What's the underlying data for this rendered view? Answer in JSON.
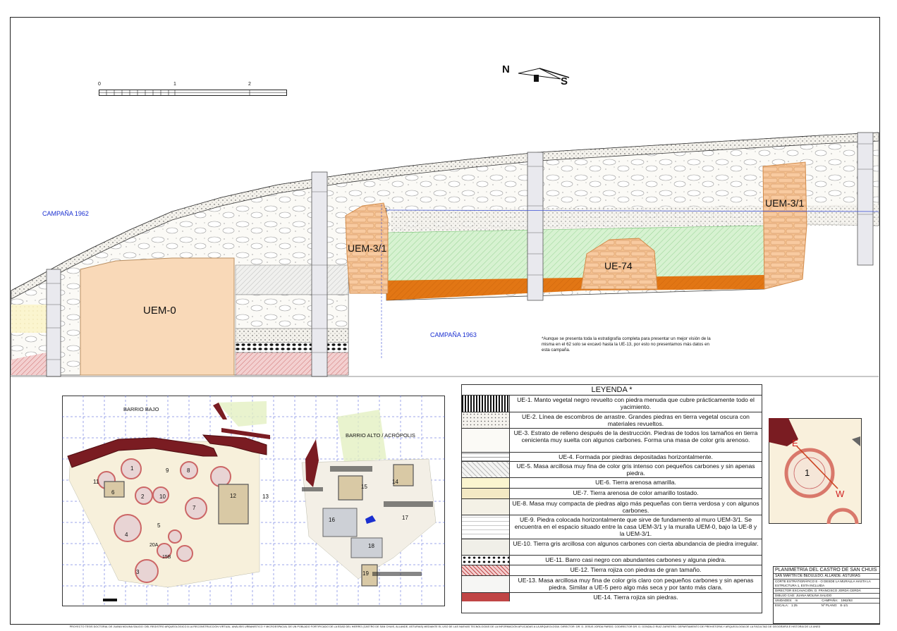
{
  "orientation": {
    "north": "N",
    "south": "S"
  },
  "scale_bar": {
    "labels": [
      "0",
      "1",
      "2"
    ]
  },
  "section": {
    "campaign_1962": "CAMPAÑA 1962",
    "campaign_1963": "CAMPAÑA 1963",
    "walls": {
      "uem0": "UEM-0",
      "uem31_a": "UEM-3/1",
      "uem31_b": "UEM-3/1",
      "ue74": "UE-74"
    },
    "note": "*Aunque se presenta toda la estratigrafía completa para presentar un mejor visión de la misma en el 62 solo se excavó hasta la UE-13, por esto no presentamos más datos en esta campaña."
  },
  "plan": {
    "barrio_bajo": "BARRIO BAJO",
    "barrio_alto": "BARRIO ALTO / ACRÓPOLIS",
    "numbers": [
      "1",
      "2",
      "3",
      "4",
      "5",
      "6",
      "7",
      "8",
      "9",
      "10",
      "11",
      "12",
      "13",
      "14",
      "15",
      "16",
      "17",
      "18",
      "19",
      "15B",
      "20A"
    ]
  },
  "inset": {
    "e": "E",
    "w": "W",
    "n1": "1"
  },
  "legend": {
    "title": "LEYENDA *",
    "rows": [
      "UE-1. Manto vegetal negro revuelto con piedra menuda que cubre prácticamente todo el yacimiento.",
      "UE-2. Línea de escombros de arrastre. Grandes piedras en tierra vegetal oscura con materiales revueltos.",
      "UE-3. Estrato de relleno después de la destrucción. Piedras de todos los tamaños en tierra cenicienta muy suelta con algunos carbones. Forma una masa de color gris arenoso.",
      "UE-4. Formada por piedras depositadas horizontalmente.",
      "UE-5. Masa arcillosa muy fina de color gris intenso con pequeños carbones y sin apenas piedra.",
      "UE-6. Tierra arenosa amarilla.",
      "UE-7. Tierra arenosa de color amarillo tostado.",
      "UE-8. Masa muy compacta de piedras algo más pequeñas con tierra verdosa y con algunos carbones.",
      "UE-9. Piedra colocada horizontalmente que sirve de fundamento al muro UEM-3/1. Se encuentra en el espacio situado entre la casa UEM-3/1 y la muralla UEM-0, bajo la UE-8 y la UEM-3/1.",
      "UE-10. Tierra gris arcillosa con algunos carbones con cierta abundancia de piedra irregular.",
      "UE-11. Barro casi negro con abundantes carbones y alguna piedra.",
      "UE-12. Tierra rojiza con piedras de gran tamaño.",
      "UE-13. Masa arcillosa muy fina de color gris claro con pequeños carbones y sin apenas piedra. Similar a UE-5 pero algo más seca y por tanto más clara.",
      "UE-14. Tierra rojiza sin piedras."
    ]
  },
  "titleblock": {
    "title": "PLANIMETRÍA DEL CASTRO DE SAN CHUIS",
    "subtitle": "SAN MARTÍN DE BEDULEDO. ALLANDE. ASTURIAS",
    "desc": "CORTE ESTRATIGRÁFICO E - O DESDE LA MURALLA HASTA LA ESTRUCTURA 1, ESTA INCLUIDA",
    "director": "DIRECTOR EXCAVACIÓN: D. FRANCISCO JORDÁ CERDÁ",
    "drawing": "DIBUJO CAD: JUANA MOLINA SALIDO",
    "units_label": "UNIDADES:",
    "units": "m",
    "campaign_label": "CAMPAÑA:",
    "campaign": "1962/63",
    "scale_label": "ESCALA:",
    "scale": "1:25",
    "plane_label": "Nº PLANO:",
    "plane": "E-1/1"
  },
  "footer": "PROYECTO TESIS DOCTORAL DE JUANA MOLINA SALIDO: DEL REGISTRO ARQUEOLÓGICO A LA RECONSTRUCCIÓN VIRTUAL. ANÁLISIS URBANÍSTICO Y MICROESPACIAL DE UN POBLADO FORTIFICADO DE LA EDAD DEL HIERRO (CASTRO DE SAN CHUIS, ALLANDE, ASTURIAS) MEDIANTE EL USO DE LAS NUEVAS TECNOLOGÍAS DE LA INFORMACIÓN APLICADAS A LA ARQUEOLOGÍA. DIRECTOR: DR. D. JESÚS JORDÁ PARDO; CODIRECTOR DR. D. GONZALO RUIZ ZAPATERO. DEPARTAMENTO DE PREHISTORIA Y ARQUEOLOGÍA DE LA FACULTAD DE GEOGRAFÍA E HISTORIA DE LA UNED",
  "colors": {
    "wall": "#f5c18f",
    "wall_orange": "#e07a1c",
    "green": "#c9efc6",
    "mortar": "#7a1c22",
    "grid": "#3a4fd6"
  }
}
